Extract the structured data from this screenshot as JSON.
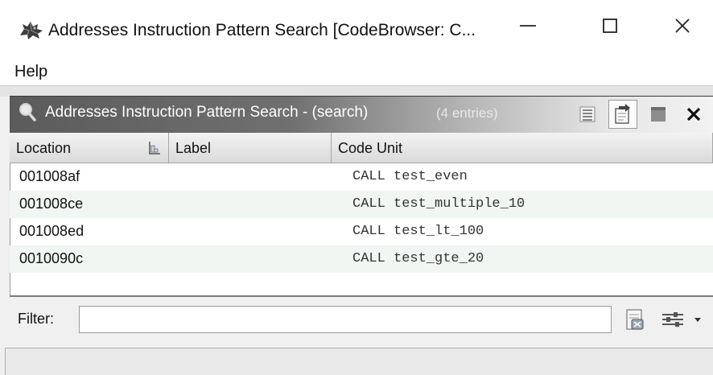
{
  "window": {
    "title": "Addresses Instruction Pattern Search [CodeBrowser: C...",
    "icon": "dragon-icon",
    "controls": [
      "minimize-icon",
      "maximize-icon",
      "close-icon"
    ]
  },
  "menu": {
    "items": [
      {
        "label": "Help"
      }
    ]
  },
  "panel": {
    "title": "Addresses Instruction Pattern Search - (search)",
    "count_text": "(4 entries)",
    "toolbar_icons": [
      "list-view-icon",
      "navigate-icon",
      "snapshot-icon",
      "close-icon"
    ]
  },
  "table": {
    "columns": [
      "Location",
      "Label",
      "Code Unit"
    ],
    "rows": [
      {
        "location": "001008af",
        "label": "",
        "code_unit": "CALL test_even"
      },
      {
        "location": "001008ce",
        "label": "",
        "code_unit": "CALL test_multiple_10"
      },
      {
        "location": "001008ed",
        "label": "",
        "code_unit": "CALL test_lt_100"
      },
      {
        "location": "0010090c",
        "label": "",
        "code_unit": "CALL test_gte_20"
      }
    ]
  },
  "filter": {
    "label": "Filter:",
    "value": ""
  },
  "colors": {
    "panel_header_dark": "#5b5b5b",
    "row_alt": "#f0f6f2"
  }
}
